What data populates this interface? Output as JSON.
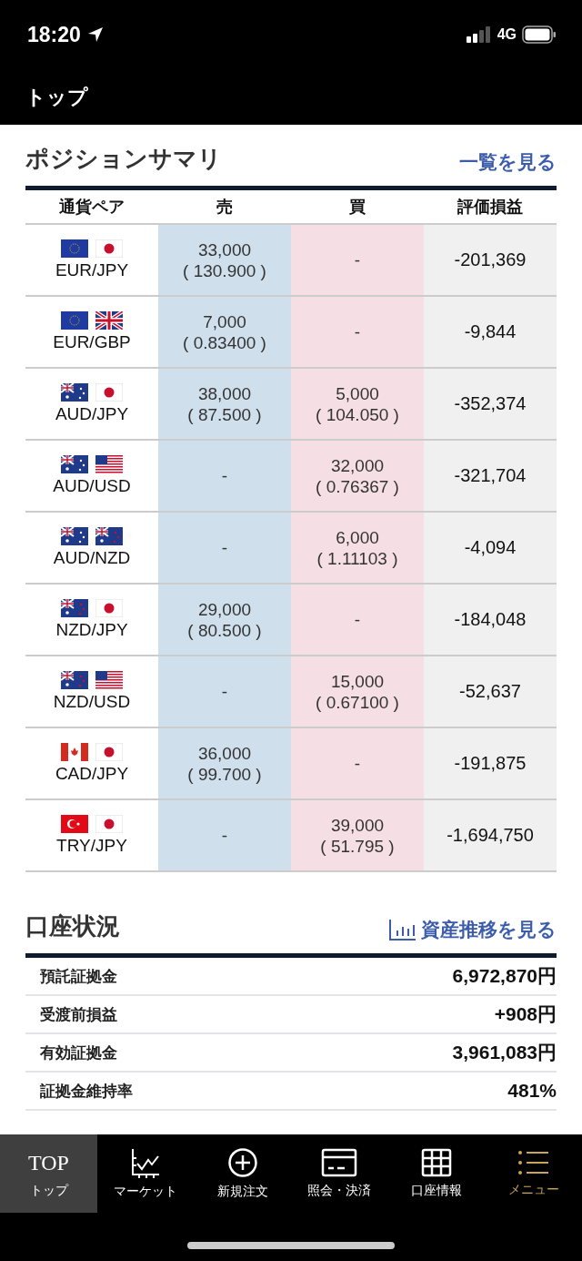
{
  "status_bar": {
    "time": "18:20",
    "network": "4G"
  },
  "header": {
    "title": "トップ"
  },
  "positions": {
    "title": "ポジションサマリ",
    "link": "一覧を見る",
    "columns": [
      "通貨ペア",
      "売",
      "買",
      "評価損益"
    ],
    "rows": [
      {
        "flags": [
          {
            "kind": "eu"
          },
          {
            "kind": "jp"
          }
        ],
        "pair": "EUR/JPY",
        "sell": {
          "amount": "33,000",
          "rate": "( 130.900 )"
        },
        "buy": {
          "amount": "-"
        },
        "pl": "-201,369"
      },
      {
        "flags": [
          {
            "kind": "eu"
          },
          {
            "kind": "gb"
          }
        ],
        "pair": "EUR/GBP",
        "sell": {
          "amount": "7,000",
          "rate": "( 0.83400 )"
        },
        "buy": {
          "amount": "-"
        },
        "pl": "-9,844"
      },
      {
        "flags": [
          {
            "kind": "au"
          },
          {
            "kind": "jp"
          }
        ],
        "pair": "AUD/JPY",
        "sell": {
          "amount": "38,000",
          "rate": "( 87.500 )"
        },
        "buy": {
          "amount": "5,000",
          "rate": "( 104.050 )"
        },
        "pl": "-352,374"
      },
      {
        "flags": [
          {
            "kind": "au"
          },
          {
            "kind": "us"
          }
        ],
        "pair": "AUD/USD",
        "sell": {
          "amount": "-"
        },
        "buy": {
          "amount": "32,000",
          "rate": "( 0.76367 )"
        },
        "pl": "-321,704"
      },
      {
        "flags": [
          {
            "kind": "au"
          },
          {
            "kind": "nz"
          }
        ],
        "pair": "AUD/NZD",
        "sell": {
          "amount": "-"
        },
        "buy": {
          "amount": "6,000",
          "rate": "( 1.11103 )"
        },
        "pl": "-4,094"
      },
      {
        "flags": [
          {
            "kind": "nz"
          },
          {
            "kind": "jp"
          }
        ],
        "pair": "NZD/JPY",
        "sell": {
          "amount": "29,000",
          "rate": "( 80.500 )"
        },
        "buy": {
          "amount": "-"
        },
        "pl": "-184,048"
      },
      {
        "flags": [
          {
            "kind": "nz"
          },
          {
            "kind": "us"
          }
        ],
        "pair": "NZD/USD",
        "sell": {
          "amount": "-"
        },
        "buy": {
          "amount": "15,000",
          "rate": "( 0.67100 )"
        },
        "pl": "-52,637"
      },
      {
        "flags": [
          {
            "kind": "ca"
          },
          {
            "kind": "jp"
          }
        ],
        "pair": "CAD/JPY",
        "sell": {
          "amount": "36,000",
          "rate": "( 99.700 )"
        },
        "buy": {
          "amount": "-"
        },
        "pl": "-191,875"
      },
      {
        "flags": [
          {
            "kind": "tr"
          },
          {
            "kind": "jp"
          }
        ],
        "pair": "TRY/JPY",
        "sell": {
          "amount": "-"
        },
        "buy": {
          "amount": "39,000",
          "rate": "( 51.795 )"
        },
        "pl": "-1,694,750"
      }
    ]
  },
  "account": {
    "title": "口座状況",
    "link": "資産推移を見る",
    "rows": [
      {
        "label": "預託証拠金",
        "value": "6,972,870円"
      },
      {
        "label": "受渡前損益",
        "value": "+908円"
      },
      {
        "label": "有効証拠金",
        "value": "3,961,083円"
      },
      {
        "label": "証拠金維持率",
        "value": "481%"
      }
    ]
  },
  "tab_bar": [
    {
      "kind": "text",
      "icon_text": "TOP",
      "label": "トップ",
      "selected": true,
      "accent": false
    },
    {
      "kind": "chart",
      "label": "マーケット",
      "selected": false,
      "accent": false
    },
    {
      "kind": "plus",
      "label": "新規注文",
      "selected": false,
      "accent": false
    },
    {
      "kind": "card",
      "label": "照会・決済",
      "selected": false,
      "accent": false
    },
    {
      "kind": "grid",
      "label": "口座情報",
      "selected": false,
      "accent": false
    },
    {
      "kind": "menu",
      "label": "メニュー",
      "selected": false,
      "accent": true
    }
  ]
}
